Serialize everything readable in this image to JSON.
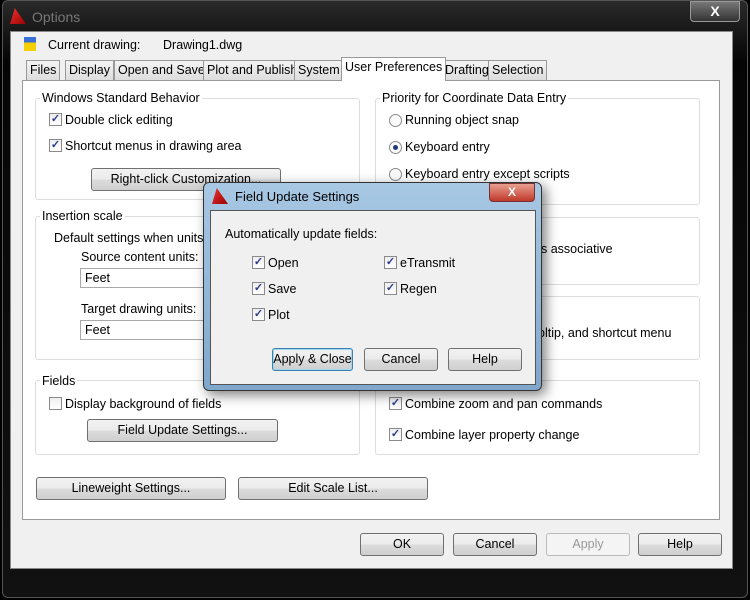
{
  "window": {
    "title": "Options",
    "close_label": "X"
  },
  "current_drawing": {
    "label": "Current drawing:",
    "value": "Drawing1.dwg"
  },
  "tabs": [
    {
      "label": "Files"
    },
    {
      "label": "Display"
    },
    {
      "label": "Open and Save"
    },
    {
      "label": "Plot and Publish"
    },
    {
      "label": "System"
    },
    {
      "label": "User Preferences",
      "active": true
    },
    {
      "label": "Drafting"
    },
    {
      "label": "Selection"
    }
  ],
  "windows_behavior": {
    "title": "Windows Standard Behavior",
    "double_click": "Double click editing",
    "shortcut_menus": "Shortcut menus in drawing area",
    "right_click_button": "Right-click Customization..."
  },
  "insertion_scale": {
    "title": "Insertion scale",
    "default_text": "Default settings when units are",
    "source_label": "Source content units:",
    "source_value": "Feet",
    "target_label": "Target drawing units:",
    "target_value": "Feet"
  },
  "fields": {
    "title": "Fields",
    "display_background": "Display background of fields",
    "update_button": "Field Update Settings..."
  },
  "priority": {
    "title": "Priority for Coordinate Data Entry",
    "options": [
      "Running object snap",
      "Keyboard entry",
      "Keyboard entry except scripts"
    ],
    "selected": "Keyboard entry"
  },
  "partial": {
    "associative": "s associative",
    "tooltip": "oltip, and shortcut menu"
  },
  "undo": {
    "combine_zoom": "Combine zoom and pan commands",
    "combine_layer": "Combine layer property change"
  },
  "bottom_buttons": {
    "lineweight": "Lineweight Settings...",
    "edit_scale": "Edit Scale List..."
  },
  "footer": {
    "ok": "OK",
    "cancel": "Cancel",
    "apply": "Apply",
    "help": "Help"
  },
  "dialog": {
    "title": "Field Update Settings",
    "close_label": "X",
    "heading": "Automatically update fields:",
    "checks": {
      "open": "Open",
      "save": "Save",
      "plot": "Plot",
      "etransmit": "eTransmit",
      "regen": "Regen"
    },
    "apply_close": "Apply & Close",
    "cancel": "Cancel",
    "help": "Help"
  }
}
